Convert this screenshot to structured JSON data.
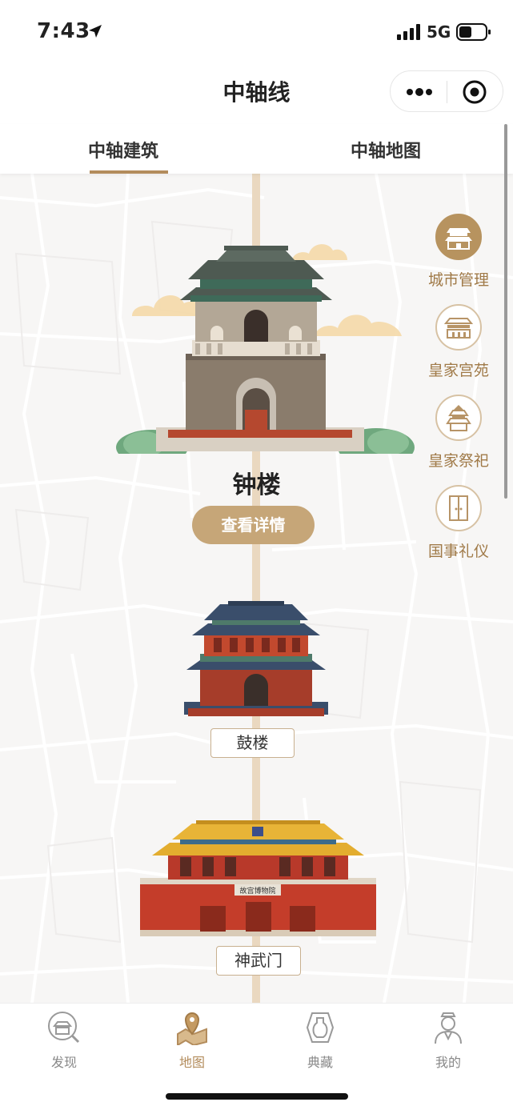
{
  "status_bar": {
    "time": "7:43",
    "network": "5G"
  },
  "nav": {
    "title": "中轴线"
  },
  "tabs": [
    {
      "label": "中轴建筑",
      "active": true
    },
    {
      "label": "中轴地图",
      "active": false
    }
  ],
  "buildings": {
    "bell": {
      "name": "钟楼",
      "detail_button": "查看详情"
    },
    "drum": {
      "name": "鼓楼"
    },
    "shenwu": {
      "name": "神武门",
      "plaque": "故宫博物院"
    }
  },
  "side_categories": [
    {
      "label": "城市管理",
      "icon": "city-gate-icon",
      "active": true
    },
    {
      "label": "皇家宫苑",
      "icon": "palace-icon",
      "active": false
    },
    {
      "label": "皇家祭祀",
      "icon": "temple-icon",
      "active": false
    },
    {
      "label": "国事礼仪",
      "icon": "door-icon",
      "active": false
    }
  ],
  "tab_bar": [
    {
      "label": "发现",
      "icon": "discover-icon",
      "active": false
    },
    {
      "label": "地图",
      "icon": "map-icon",
      "active": true
    },
    {
      "label": "典藏",
      "icon": "collection-icon",
      "active": false
    },
    {
      "label": "我的",
      "icon": "profile-icon",
      "active": false
    }
  ],
  "colors": {
    "accent": "#b38c5c",
    "button": "#c6a678",
    "axis": "#ead8c0"
  }
}
